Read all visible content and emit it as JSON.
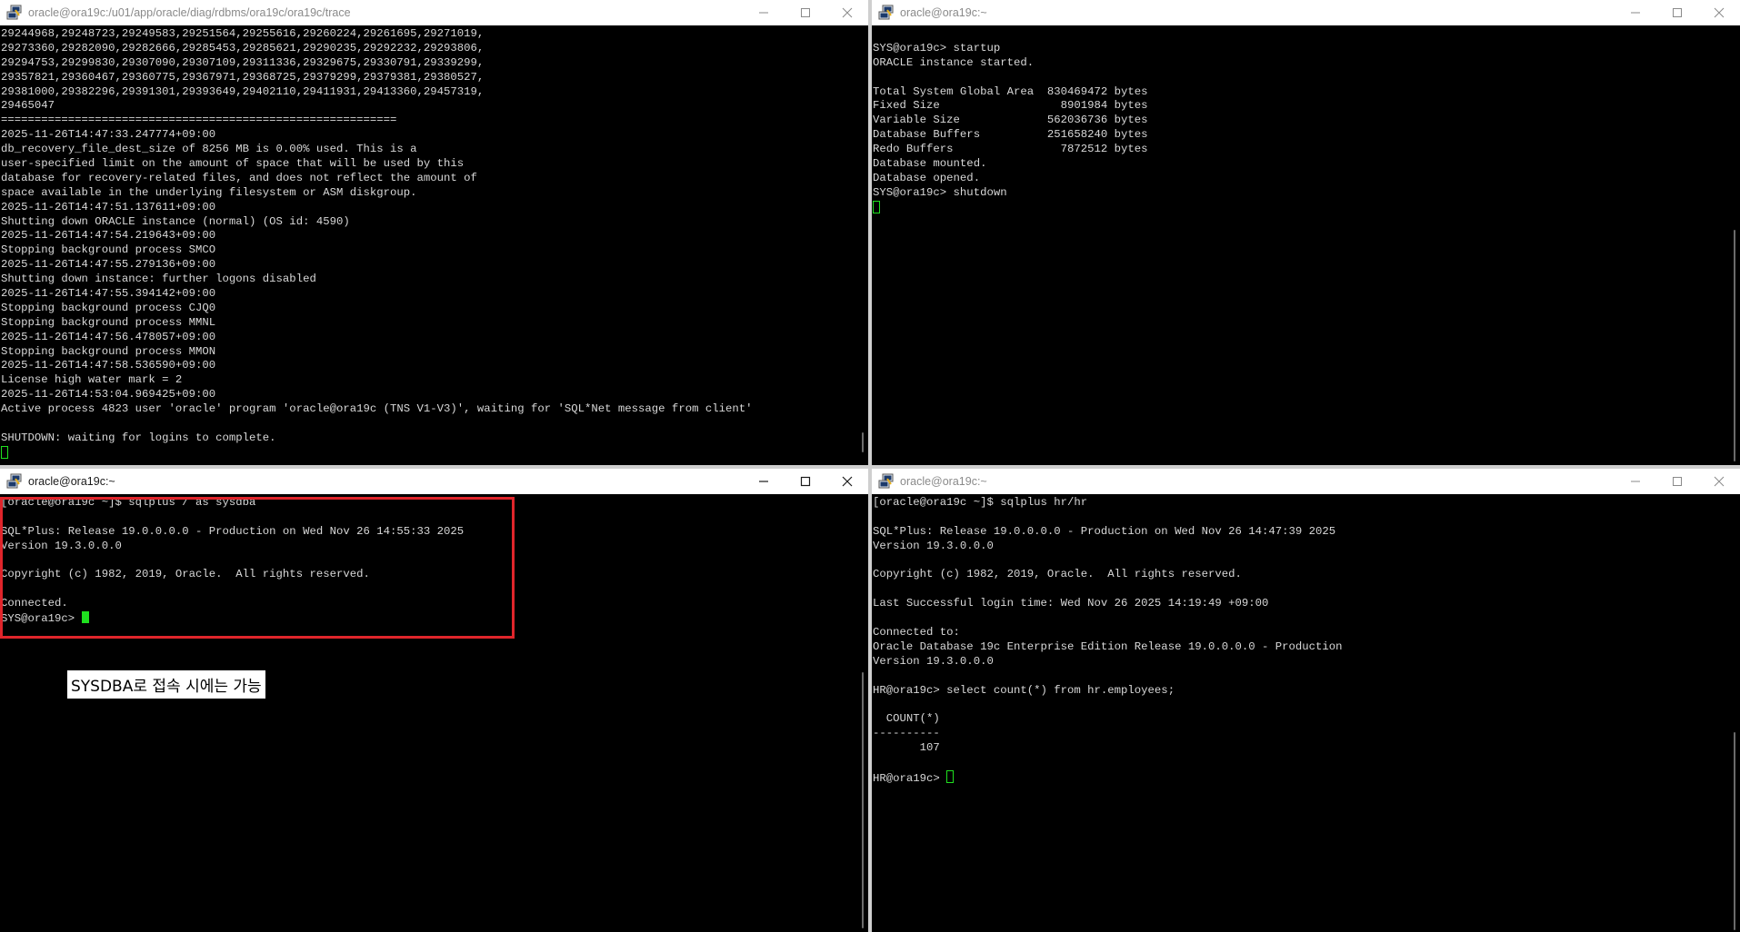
{
  "windows": {
    "top_left": {
      "title": "oracle@ora19c:/u01/app/oracle/diag/rdbms/ora19c/ora19c/trace",
      "lines": [
        "29244968,29248723,29249583,29251564,29255616,29260224,29261695,29271019,",
        "29273360,29282090,29282666,29285453,29285621,29290235,29292232,29293806,",
        "29294753,29299830,29307090,29307109,29311336,29329675,29330791,29339299,",
        "29357821,29360467,29360775,29367971,29368725,29379299,29379381,29380527,",
        "29381000,29382296,29391301,29393649,29402110,29411931,29413360,29457319,",
        "29465047",
        "===========================================================",
        "2025-11-26T14:47:33.247774+09:00",
        "db_recovery_file_dest_size of 8256 MB is 0.00% used. This is a",
        "user-specified limit on the amount of space that will be used by this",
        "database for recovery-related files, and does not reflect the amount of",
        "space available in the underlying filesystem or ASM diskgroup.",
        "2025-11-26T14:47:51.137611+09:00",
        "Shutting down ORACLE instance (normal) (OS id: 4590)",
        "2025-11-26T14:47:54.219643+09:00",
        "Stopping background process SMCO",
        "2025-11-26T14:47:55.279136+09:00",
        "Shutting down instance: further logons disabled",
        "2025-11-26T14:47:55.394142+09:00",
        "Stopping background process CJQ0",
        "Stopping background process MMNL",
        "2025-11-26T14:47:56.478057+09:00",
        "Stopping background process MMON",
        "2025-11-26T14:47:58.536590+09:00",
        "License high water mark = 2",
        "2025-11-26T14:53:04.969425+09:00",
        "Active process 4823 user 'oracle' program 'oracle@ora19c (TNS V1-V3)', waiting for 'SQL*Net message from client'",
        "",
        "SHUTDOWN: waiting for logins to complete."
      ]
    },
    "top_right": {
      "title": "oracle@ora19c:~",
      "lines": [
        "",
        "SYS@ora19c> startup",
        "ORACLE instance started.",
        "",
        "Total System Global Area  830469472 bytes",
        "Fixed Size                  8901984 bytes",
        "Variable Size             562036736 bytes",
        "Database Buffers          251658240 bytes",
        "Redo Buffers                7872512 bytes",
        "Database mounted.",
        "Database opened.",
        "SYS@ora19c> shutdown"
      ]
    },
    "bottom_left": {
      "title": "oracle@ora19c:~",
      "lines": [
        "[oracle@ora19c ~]$ sqlplus / as sysdba",
        "",
        "SQL*Plus: Release 19.0.0.0.0 - Production on Wed Nov 26 14:55:33 2025",
        "Version 19.3.0.0.0",
        "",
        "Copyright (c) 1982, 2019, Oracle.  All rights reserved.",
        "",
        "Connected."
      ],
      "prompt": "SYS@ora19c> "
    },
    "bottom_right": {
      "title": "oracle@ora19c:~",
      "lines": [
        "[oracle@ora19c ~]$ sqlplus hr/hr",
        "",
        "SQL*Plus: Release 19.0.0.0.0 - Production on Wed Nov 26 14:47:39 2025",
        "Version 19.3.0.0.0",
        "",
        "Copyright (c) 1982, 2019, Oracle.  All rights reserved.",
        "",
        "Last Successful login time: Wed Nov 26 2025 14:19:49 +09:00",
        "",
        "Connected to:",
        "Oracle Database 19c Enterprise Edition Release 19.0.0.0.0 - Production",
        "Version 19.3.0.0.0",
        "",
        "HR@ora19c> select count(*) from hr.employees;",
        "",
        "  COUNT(*)",
        "----------",
        "       107",
        ""
      ],
      "prompt": "HR@ora19c> "
    }
  },
  "annotation": {
    "text": "SYSDBA로 접속 시에는 가능"
  },
  "colors": {
    "highlight_box": "#e0252b",
    "cursor": "#1fe01f",
    "terminal_bg": "#000000",
    "terminal_fg": "#d8d8d8"
  },
  "icons": {
    "app": "putty-icon",
    "minimize": "minimize-icon",
    "maximize": "maximize-icon",
    "close": "close-icon"
  }
}
